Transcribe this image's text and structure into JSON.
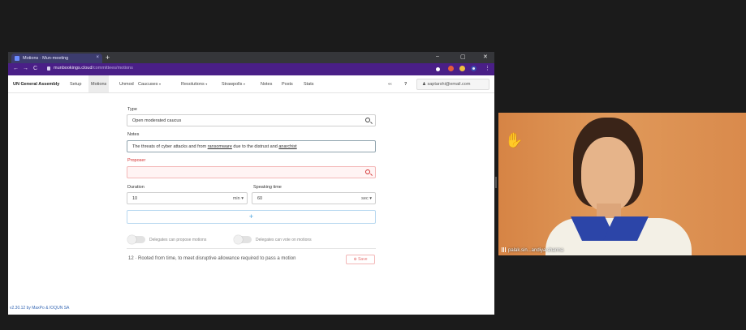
{
  "browser": {
    "tab_title": "Motions · Mun-meeting",
    "tab_close": "×",
    "new_tab": "+",
    "win_min": "–",
    "win_max": "▢",
    "win_close": "✕",
    "nav_back": "←",
    "nav_forward": "→",
    "nav_reload": "C",
    "url_host": "munbookings.cloud",
    "url_path": "/committees/motions"
  },
  "appnav": {
    "brand": "UN General Assembly",
    "items": [
      "Setup",
      "Motions",
      "Unmod",
      "Caucuses",
      "Resolutions",
      "Strawpolls",
      "Notes",
      "Posts",
      "Stats"
    ],
    "caret": "▾",
    "help": "?",
    "share": "«‹",
    "user_label": "saptarshi@email.com"
  },
  "form": {
    "type_label": "Type",
    "type_value": "Open moderated caucus",
    "notes_label": "Notes",
    "notes_prefix": "The threats of cyber attacks and from ",
    "notes_link1": "ransomware",
    "notes_middle": " due to the distrust and ",
    "notes_link2": "anarchist",
    "proposer_label": "Proposer",
    "proposer_value": "",
    "duration_label": "Duration",
    "duration_value": "10",
    "duration_unit": "min ▾",
    "speaking_label": "Speaking time",
    "speaking_value": "60",
    "speaking_unit": "sec ▾",
    "add_symbol": "+",
    "toggle1_label": "Delegates can propose motions",
    "toggle2_label": "Delegates can vote on motions",
    "threshold_text": "12 · Rooted from time, to meet disruptive allowance required to pass a motion",
    "save_label": "⊕ Save"
  },
  "footer": {
    "version": "v2.30.12 by MaxPo & IOQUN SA"
  },
  "webcam": {
    "raise_hand": "✋",
    "participant_name": "palak.sin...andiya sharma"
  },
  "colors": {
    "tabstrip": "#35363a",
    "addressbar": "#4a1f87",
    "error": "#d32f2f",
    "link": "#3a6ab5",
    "cam_background": "#d98c4a",
    "shirt_collar": "#2c45a8"
  }
}
